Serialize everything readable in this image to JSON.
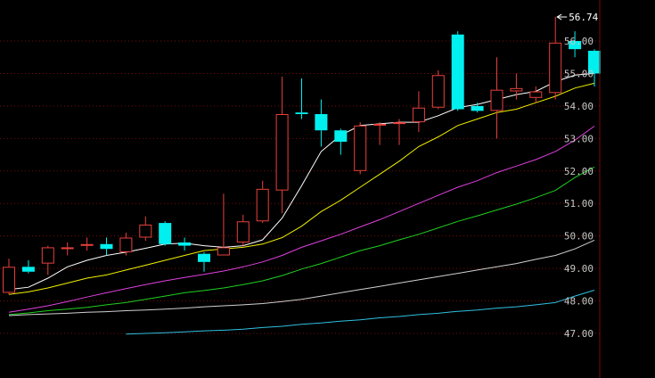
{
  "chart_data": {
    "type": "candlestick",
    "title": "",
    "xlabel": "",
    "ylabel": "",
    "ylim": [
      46.6,
      56.9
    ],
    "yticks": [
      56.0,
      55.0,
      54.0,
      53.0,
      52.0,
      51.0,
      50.0,
      49.0,
      48.0,
      47.0
    ],
    "ytick_labels": [
      "56.00",
      "55.00",
      "54.00",
      "53.00",
      "52.00",
      "51.00",
      "50.00",
      "49.00",
      "48.00",
      "47.00"
    ],
    "grid": true,
    "colors": {
      "up": "#e8413c",
      "down": "#00f0f0",
      "grid": "#7a0a0a",
      "ma5": "#ffffff",
      "ma10": "#f0f000",
      "ma20": "#e040e0",
      "ma30": "#20d020",
      "ma60": "#d0d0d0",
      "ma120": "#30c0e0"
    },
    "candles": [
      {
        "o": 48.25,
        "h": 49.3,
        "l": 48.2,
        "c": 49.05
      },
      {
        "o": 49.05,
        "h": 49.25,
        "l": 48.85,
        "c": 48.9
      },
      {
        "o": 49.15,
        "h": 49.7,
        "l": 48.8,
        "c": 49.65
      },
      {
        "o": 49.65,
        "h": 49.8,
        "l": 49.4,
        "c": 49.65
      },
      {
        "o": 49.7,
        "h": 49.95,
        "l": 49.55,
        "c": 49.75
      },
      {
        "o": 49.75,
        "h": 49.95,
        "l": 49.4,
        "c": 49.6
      },
      {
        "o": 49.5,
        "h": 50.1,
        "l": 49.4,
        "c": 49.95
      },
      {
        "o": 49.95,
        "h": 50.6,
        "l": 49.85,
        "c": 50.35
      },
      {
        "o": 50.4,
        "h": 50.45,
        "l": 49.7,
        "c": 49.75
      },
      {
        "o": 49.8,
        "h": 49.95,
        "l": 49.55,
        "c": 49.7
      },
      {
        "o": 49.45,
        "h": 49.5,
        "l": 48.9,
        "c": 49.2
      },
      {
        "o": 49.4,
        "h": 51.3,
        "l": 49.4,
        "c": 49.65
      },
      {
        "o": 49.8,
        "h": 50.65,
        "l": 49.7,
        "c": 50.45
      },
      {
        "o": 50.45,
        "h": 51.7,
        "l": 50.4,
        "c": 51.45
      },
      {
        "o": 51.4,
        "h": 54.9,
        "l": 50.7,
        "c": 53.75
      },
      {
        "o": 53.8,
        "h": 54.85,
        "l": 53.6,
        "c": 53.75
      },
      {
        "o": 53.75,
        "h": 54.2,
        "l": 52.75,
        "c": 53.25
      },
      {
        "o": 53.25,
        "h": 53.3,
        "l": 52.5,
        "c": 52.9
      },
      {
        "o": 52.0,
        "h": 53.5,
        "l": 51.9,
        "c": 53.4
      },
      {
        "o": 53.4,
        "h": 53.5,
        "l": 52.8,
        "c": 53.45
      },
      {
        "o": 53.45,
        "h": 53.6,
        "l": 52.8,
        "c": 53.5
      },
      {
        "o": 53.5,
        "h": 54.45,
        "l": 53.2,
        "c": 53.95
      },
      {
        "o": 53.95,
        "h": 55.1,
        "l": 53.9,
        "c": 54.95
      },
      {
        "o": 56.2,
        "h": 56.3,
        "l": 53.85,
        "c": 53.9
      },
      {
        "o": 54.0,
        "h": 54.1,
        "l": 53.8,
        "c": 53.85
      },
      {
        "o": 53.85,
        "h": 55.5,
        "l": 53.0,
        "c": 54.5
      },
      {
        "o": 54.45,
        "h": 55.0,
        "l": 54.2,
        "c": 54.55
      },
      {
        "o": 54.25,
        "h": 54.6,
        "l": 54.1,
        "c": 54.45
      },
      {
        "o": 54.4,
        "h": 56.74,
        "l": 54.2,
        "c": 55.95
      },
      {
        "o": 56.0,
        "h": 56.3,
        "l": 55.5,
        "c": 55.75
      },
      {
        "o": 55.7,
        "h": 55.75,
        "l": 54.6,
        "c": 55.0
      }
    ],
    "ma_series": [
      {
        "key": "ma5",
        "values": [
          48.35,
          48.42,
          48.7,
          49.05,
          49.25,
          49.4,
          49.5,
          49.62,
          49.75,
          49.78,
          49.7,
          49.65,
          49.7,
          49.88,
          50.55,
          51.55,
          52.6,
          53.1,
          53.4,
          53.45,
          53.5,
          53.5,
          53.7,
          53.95,
          54.05,
          54.2,
          54.35,
          54.45,
          54.75,
          54.95,
          55.0
        ]
      },
      {
        "key": "ma10",
        "values": [
          48.2,
          48.28,
          48.4,
          48.55,
          48.7,
          48.8,
          48.95,
          49.1,
          49.25,
          49.4,
          49.55,
          49.6,
          49.65,
          49.75,
          49.95,
          50.3,
          50.75,
          51.1,
          51.5,
          51.9,
          52.3,
          52.75,
          53.05,
          53.4,
          53.6,
          53.8,
          53.9,
          54.1,
          54.3,
          54.55,
          54.7
        ]
      },
      {
        "key": "ma20",
        "values": [
          47.65,
          47.75,
          47.85,
          47.98,
          48.12,
          48.25,
          48.38,
          48.5,
          48.62,
          48.72,
          48.82,
          48.92,
          49.05,
          49.2,
          49.4,
          49.65,
          49.85,
          50.05,
          50.28,
          50.5,
          50.75,
          51.0,
          51.25,
          51.5,
          51.7,
          51.95,
          52.15,
          52.35,
          52.6,
          52.95,
          53.38
        ]
      },
      {
        "key": "ma30",
        "values": [
          47.58,
          47.63,
          47.7,
          47.75,
          47.8,
          47.88,
          47.95,
          48.05,
          48.15,
          48.25,
          48.32,
          48.4,
          48.5,
          48.62,
          48.78,
          48.98,
          49.15,
          49.35,
          49.55,
          49.7,
          49.88,
          50.05,
          50.25,
          50.45,
          50.62,
          50.8,
          50.98,
          51.18,
          51.4,
          51.8,
          52.12
        ]
      },
      {
        "key": "ma60",
        "values": [
          47.55,
          47.58,
          47.6,
          47.62,
          47.65,
          47.67,
          47.7,
          47.72,
          47.75,
          47.78,
          47.82,
          47.85,
          47.88,
          47.92,
          47.98,
          48.05,
          48.15,
          48.25,
          48.35,
          48.45,
          48.55,
          48.65,
          48.75,
          48.85,
          48.95,
          49.05,
          49.15,
          49.28,
          49.4,
          49.6,
          49.87
        ]
      },
      {
        "key": "ma120",
        "values": [
          null,
          null,
          null,
          null,
          null,
          null,
          46.98,
          47.0,
          47.02,
          47.05,
          47.08,
          47.1,
          47.13,
          47.18,
          47.22,
          47.28,
          47.32,
          47.38,
          47.42,
          47.48,
          47.52,
          47.58,
          47.62,
          47.68,
          47.72,
          47.78,
          47.82,
          47.88,
          47.95,
          48.15,
          48.33
        ]
      }
    ],
    "annotations": [
      {
        "text": "56.74",
        "candle_index": 28,
        "value": 56.74
      }
    ]
  }
}
